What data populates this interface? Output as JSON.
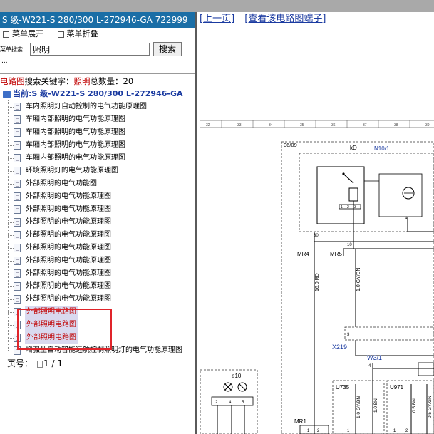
{
  "title": "S 级-W221-S 280/300 L-272946-GA 722999",
  "menu": {
    "expand_label": "菜单展开",
    "collapse_label": "菜单折叠"
  },
  "search": {
    "label": "菜单搜索",
    "value": "照明",
    "button_label": "搜索"
  },
  "ellipsis": "...",
  "summary": {
    "category": "电路图",
    "text": "搜索关键字：",
    "keyword": "照明",
    "count_label": "总数量：",
    "count": "20"
  },
  "current": {
    "label": "当前:S 级-W221-S 280/300 L-272946-GA"
  },
  "results": [
    "车内照明灯自动控制的电气功能原理图",
    "车厢内部照明的电气功能原理图",
    "车厢内部照明的电气功能原理图",
    "车厢内部照明的电气功能原理图",
    "车厢内部照明的电气功能原理图",
    "环境照明灯的电气功能原理图",
    "外部照明的电气功能图",
    "外部照明的电气功能原理图",
    "外部照明的电气功能原理图",
    "外部照明的电气功能原理图",
    "外部照明的电气功能原理图",
    "外部照明的电气功能原理图",
    "外部照明的电气功能原理图",
    "外部照明的电气功能原理图",
    "外部照明的电气功能原理图",
    "外部照明的电气功能原理图",
    "外部照明电路图",
    "外部照明电路图",
    "外部照明电路图",
    "增强型自动智能远航控制照明灯的电气功能原理图"
  ],
  "pager": {
    "label": "页号：",
    "value": "1 / 1"
  },
  "viewer": {
    "prev_link": "[上一页]",
    "terminal_link": "[查看该电路图端子]"
  },
  "diagram": {
    "grid_numbers": [
      "32",
      "33",
      "34",
      "35",
      "36",
      "37",
      "38",
      "39"
    ],
    "date_code": "06/09",
    "labels": {
      "kd": "kD",
      "n10": "N10/1",
      "mr4": "MR4",
      "mr5": "MR5",
      "x219": "X219",
      "w3": "W3/1",
      "u735": "U735",
      "u971": "U971",
      "e10": "e10",
      "mr1": "MR1"
    },
    "wires": [
      "16.0 RD",
      "1.0 GY/BN",
      "1.0 GY/BN",
      "1.0 BN",
      "0.5 BN",
      "0.5 GY/GN"
    ],
    "pins": [
      "30",
      "10",
      "4",
      "3",
      "4",
      "2",
      "4",
      "5",
      "1",
      "2",
      "1",
      "2",
      "1",
      "2"
    ]
  }
}
